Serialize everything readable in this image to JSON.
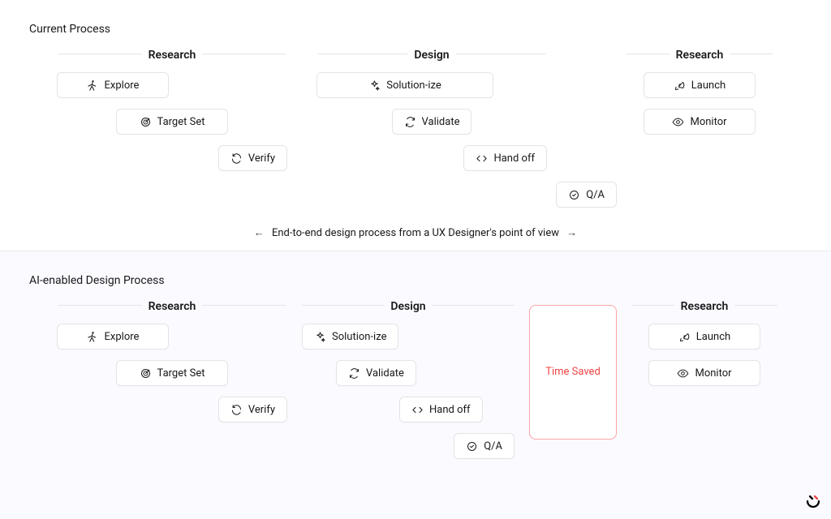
{
  "top": {
    "title": "Current Process",
    "caption": "End-to-end design process from a UX Designer's point of view",
    "columns": [
      {
        "heading": "Research",
        "steps": [
          "Explore",
          "Target Set",
          "Verify"
        ]
      },
      {
        "heading": "Design",
        "steps": [
          "Solution-ize",
          "Validate",
          "Hand off",
          "Q/A"
        ]
      },
      {
        "heading": "Research",
        "steps": [
          "Launch",
          "Monitor"
        ]
      }
    ]
  },
  "bottom": {
    "title": "AI-enabled Design Process",
    "time_saved": "Time Saved",
    "columns": [
      {
        "heading": "Research",
        "steps": [
          "Explore",
          "Target Set",
          "Verify"
        ]
      },
      {
        "heading": "Design",
        "steps": [
          "Solution-ize",
          "Validate",
          "Hand off",
          "Q/A"
        ]
      },
      {
        "heading": "Research",
        "steps": [
          "Launch",
          "Monitor"
        ]
      }
    ]
  }
}
